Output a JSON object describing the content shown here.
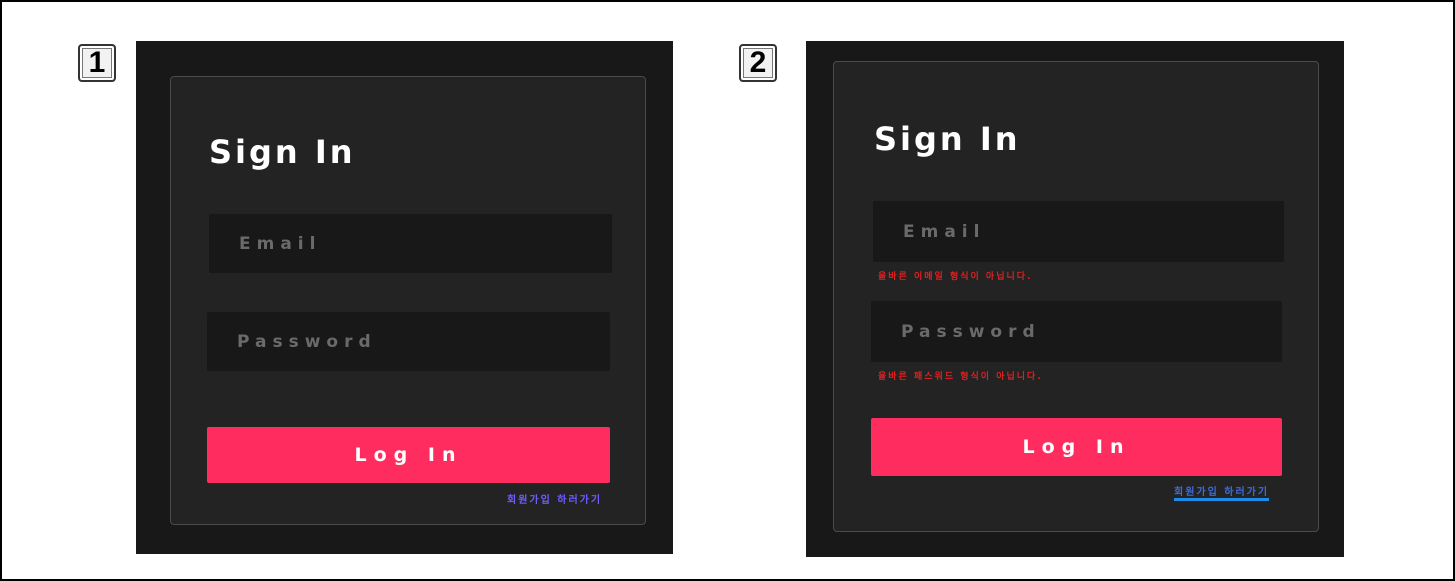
{
  "steps": [
    {
      "badge": "1",
      "title": "Sign In",
      "email": {
        "placeholder": "Email",
        "value": ""
      },
      "password": {
        "placeholder": "Password",
        "value": ""
      },
      "email_error": "",
      "password_error": "",
      "login_label": "Log In",
      "signup_link": "회원가입 하러가기"
    },
    {
      "badge": "2",
      "title": "Sign In",
      "email": {
        "placeholder": "Email",
        "value": ""
      },
      "password": {
        "placeholder": "Password",
        "value": ""
      },
      "email_error": "올바른 이메일 형식이 아닙니다.",
      "password_error": "올바른 패스워드 형식이 아닙니다.",
      "login_label": "Log In",
      "signup_link": "회원가입 하러가기"
    }
  ],
  "colors": {
    "accent": "#ff2d5f",
    "error": "#e02020",
    "link": "#6f5cff",
    "link_underline": "#1d8ce8",
    "panel_bg": "#181818",
    "card_bg": "#232323"
  }
}
